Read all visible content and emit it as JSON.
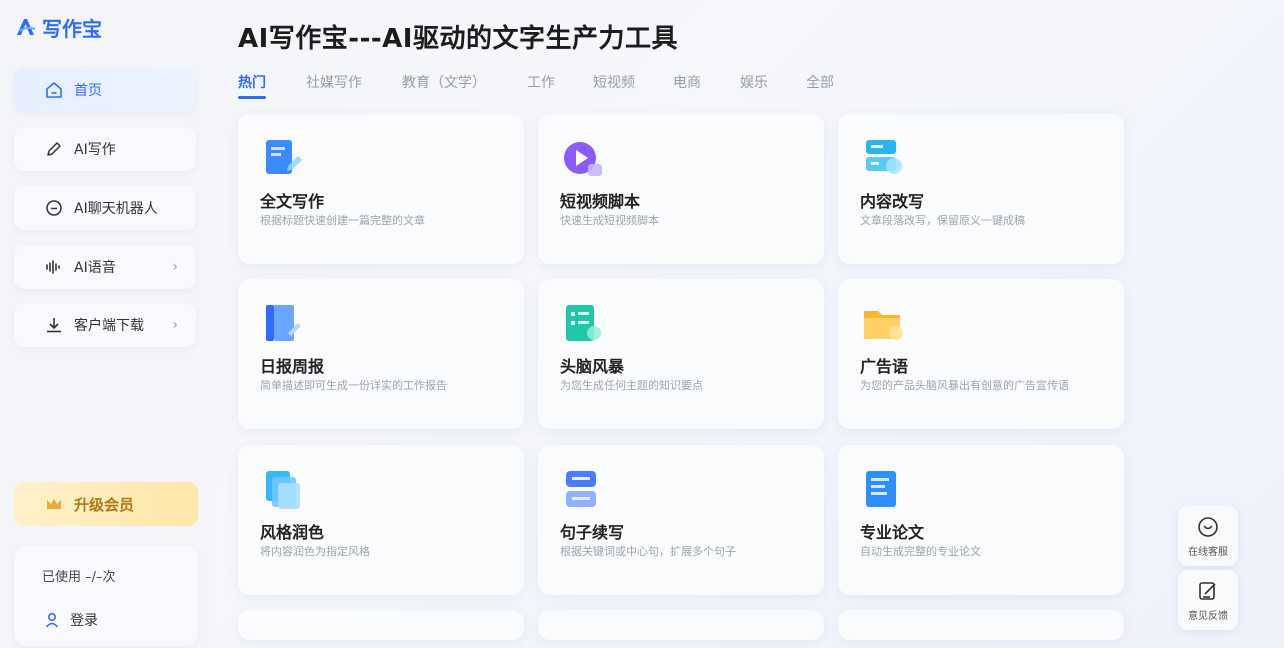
{
  "app": {
    "logo_text": "写作宝",
    "brand_color": "#2f6bff"
  },
  "sidebar": {
    "items": [
      {
        "label": "首页",
        "icon": "home-icon",
        "active": true
      },
      {
        "label": "AI写作",
        "icon": "pen-icon",
        "active": false
      },
      {
        "label": "AI聊天机器人",
        "icon": "chat-icon",
        "active": false
      },
      {
        "label": "AI语音",
        "icon": "waveform-icon",
        "active": false,
        "chevron": "›"
      },
      {
        "label": "客户端下载",
        "icon": "download-icon",
        "active": false,
        "chevron": "›"
      }
    ],
    "upgrade_label": "升级会员",
    "usage_text": "已使用 –/–次",
    "login_label": "登录"
  },
  "main": {
    "title": "AI写作宝---AI驱动的文字生产力工具",
    "tabs": [
      {
        "label": "热门",
        "active": true
      },
      {
        "label": "社媒写作"
      },
      {
        "label": "教育（文学）"
      },
      {
        "label": "工作"
      },
      {
        "label": "短视频"
      },
      {
        "label": "电商"
      },
      {
        "label": "娱乐"
      },
      {
        "label": "全部"
      }
    ],
    "cards": [
      {
        "title": "全文写作",
        "desc": "根据标题快速创建一篇完整的文章",
        "icon": "document-icon"
      },
      {
        "title": "短视频脚本",
        "desc": "快速生成短视频脚本",
        "icon": "video-play-icon"
      },
      {
        "title": "内容改写",
        "desc": "文章段落改写，保留原义一键成稿",
        "icon": "rewrite-icon"
      },
      {
        "title": "日报周报",
        "desc": "简单描述即可生成一份详实的工作报告",
        "icon": "report-book-icon"
      },
      {
        "title": "头脑风暴",
        "desc": "为您生成任何主题的知识要点",
        "icon": "brainstorm-list-icon"
      },
      {
        "title": "广告语",
        "desc": "为您的产品头脑风暴出有创意的广告宣传语",
        "icon": "ad-folder-icon"
      },
      {
        "title": "风格润色",
        "desc": "将内容润色为指定风格",
        "icon": "stacked-pages-icon"
      },
      {
        "title": "句子续写",
        "desc": "根据关键词或中心句，扩展多个句子",
        "icon": "sentence-blocks-icon"
      },
      {
        "title": "专业论文",
        "desc": "自动生成完整的专业论文",
        "icon": "paper-icon"
      }
    ]
  },
  "float": {
    "service_label": "在线客服",
    "feedback_label": "意见反馈"
  }
}
